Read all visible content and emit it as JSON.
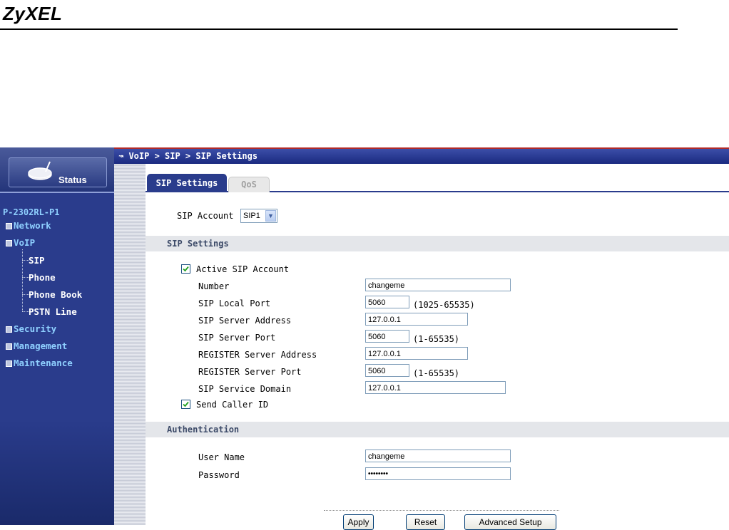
{
  "brand": {
    "logo": "ZyXEL"
  },
  "sidebar": {
    "status_label": "Status",
    "device_name": "P-2302RL-P1",
    "items": [
      {
        "label": "Network"
      },
      {
        "label": "VoIP"
      },
      {
        "label": "SIP"
      },
      {
        "label": "Phone"
      },
      {
        "label": "Phone Book"
      },
      {
        "label": "PSTN Line"
      },
      {
        "label": "Security"
      },
      {
        "label": "Management"
      },
      {
        "label": "Maintenance"
      }
    ]
  },
  "breadcrumb": "VoIP > SIP > SIP Settings",
  "tabs": [
    {
      "label": "SIP Settings",
      "active": true
    },
    {
      "label": "QoS",
      "active": false
    }
  ],
  "account": {
    "label": "SIP Account :",
    "value": "SIP1"
  },
  "sip_settings": {
    "heading": "SIP Settings",
    "active_label": "Active SIP Account",
    "number_label": "Number",
    "number_value": "changeme",
    "local_port_label": "SIP Local Port",
    "local_port_value": "5060",
    "local_port_range": "(1025-65535)",
    "server_address_label": "SIP Server Address",
    "server_address_value": "127.0.0.1",
    "server_port_label": "SIP Server Port",
    "server_port_value": "5060",
    "server_port_range": "(1-65535)",
    "register_address_label": "REGISTER Server Address",
    "register_address_value": "127.0.0.1",
    "register_port_label": "REGISTER Server Port",
    "register_port_value": "5060",
    "register_port_range": "(1-65535)",
    "domain_label": "SIP Service Domain",
    "domain_value": "127.0.0.1",
    "caller_id_label": "Send Caller ID"
  },
  "authentication": {
    "heading": "Authentication",
    "user_label": "User Name",
    "user_value": "changeme",
    "password_label": "Password",
    "password_value": "••••••••"
  },
  "buttons": {
    "apply": "Apply",
    "reset": "Reset",
    "advanced": "Advanced Setup"
  }
}
